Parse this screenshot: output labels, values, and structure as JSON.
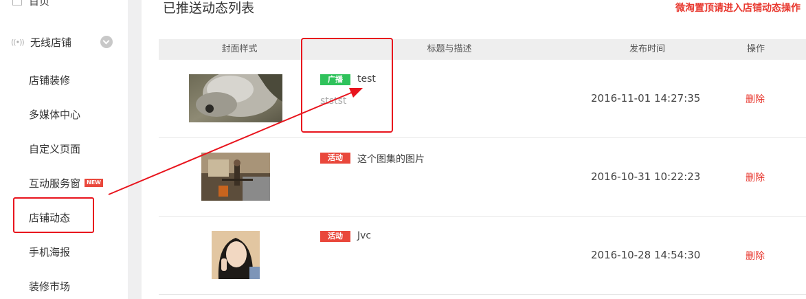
{
  "sidebar": {
    "home_label": "首页",
    "group_label": "无线店铺",
    "items": [
      {
        "label": "店铺装修"
      },
      {
        "label": "多媒体中心"
      },
      {
        "label": "自定义页面"
      },
      {
        "label": "互动服务窗",
        "badge": "NEW"
      },
      {
        "label": "店铺动态"
      },
      {
        "label": "手机海报"
      },
      {
        "label": "装修市场"
      }
    ]
  },
  "main": {
    "title": "已推送动态列表",
    "top_link": "微淘置顶请进入店铺动态操作",
    "columns": [
      "封面样式",
      "标题与描述",
      "发布时间",
      "操作"
    ],
    "rows": [
      {
        "tag": "广播",
        "tag_color": "#2fc25b",
        "title": "test",
        "desc": "ststst",
        "time": "2016-11-01 14:27:35",
        "action": "删除"
      },
      {
        "tag": "活动",
        "tag_color": "#e9473b",
        "title": "这个图集的图片",
        "desc": "",
        "time": "2016-10-31 10:22:23",
        "action": "删除"
      },
      {
        "tag": "活动",
        "tag_color": "#e9473b",
        "title": "Jvc",
        "desc": "",
        "time": "2016-10-28 14:54:30",
        "action": "删除"
      }
    ]
  },
  "colors": {
    "accent_red": "#e8372e",
    "annotation_red": "#e8141d",
    "tag_green": "#2fc25b"
  }
}
